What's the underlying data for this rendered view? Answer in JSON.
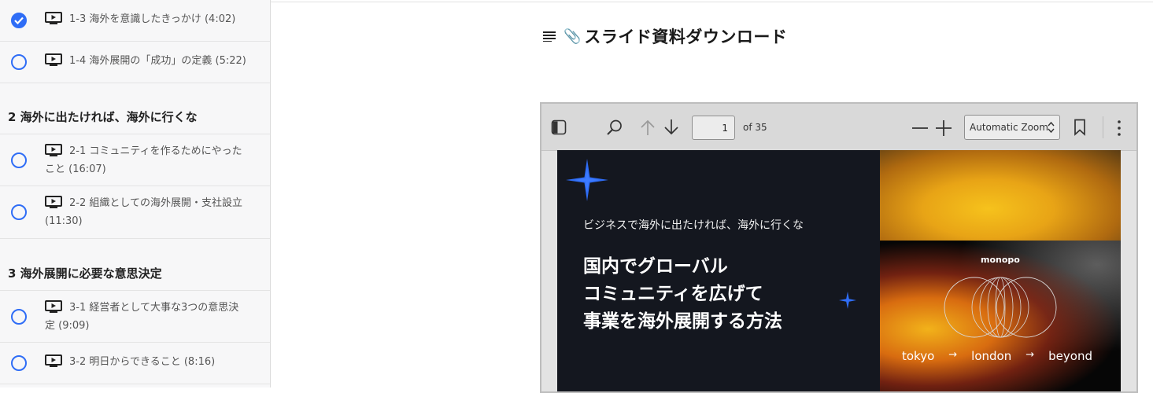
{
  "sidebar": {
    "lectures": [
      {
        "title": "1-3 海外を意識したきっかけ (4:02)",
        "done": true
      },
      {
        "title": "1-4 海外展開の「成功」の定義 (5:22)",
        "done": false
      },
      {
        "title_line1": "2-1 コミュニティを作るためにやった",
        "title_line2": "こと (16:07)",
        "done": false
      },
      {
        "title_line1": "2-2 組織としての海外展開・支社設立",
        "title_line2": "(11:30)",
        "done": false
      },
      {
        "title_line1": "3-1 経営者として大事な3つの意思決",
        "title_line2": "定 (9:09)",
        "done": false
      },
      {
        "title": "3-2 明日からできること (8:16)",
        "done": false
      }
    ],
    "sections": [
      "2 海外に出たければ、海外に行くな",
      "3 海外展開に必要な意思決定"
    ]
  },
  "main": {
    "heading_icon": "list-icon",
    "heading_emoji": "📎",
    "heading_title": "スライド資料ダウンロード"
  },
  "pdf_viewer": {
    "page_value": "1",
    "of_pages": "of 35",
    "zoom": "Automatic Zoom"
  },
  "slide": {
    "subtitle": "ビジネスで海外に出たければ、海外に行くな",
    "main_line1": "国内でグローバル",
    "main_line2": "コミュニティを広げて",
    "main_line3": "事業を海外展開する方法",
    "brand": "monopo",
    "city1": "tokyo",
    "arrow": "→",
    "city2": "london",
    "city3": "beyond",
    "accent": "#2f6df6"
  }
}
